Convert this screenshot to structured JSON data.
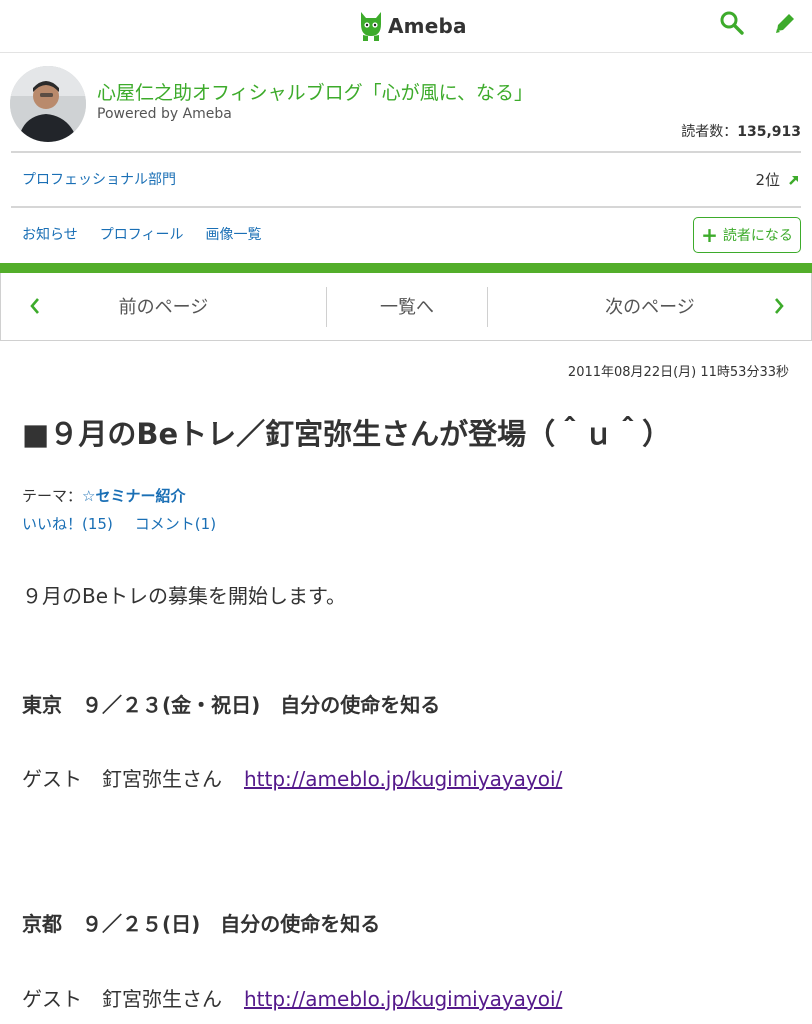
{
  "header": {
    "logo_text": "Ameba",
    "icons": [
      "search-icon",
      "pen-icon"
    ],
    "accent_color": "#3dab2b"
  },
  "profile": {
    "blog_title": "心屋仁之助オフィシャルブログ「心が風に、なる」",
    "powered_by": "Powered by Ameba",
    "readers_label": "読者数：",
    "readers_count": "135,913"
  },
  "ranking": {
    "category": "プロフェッショナル部門",
    "position": "2位"
  },
  "nav": {
    "links": [
      "お知らせ",
      "プロフィール",
      "画像一覧"
    ],
    "follow_label": "読者になる"
  },
  "pager": {
    "prev": "前のページ",
    "list": "一覧へ",
    "next": "次のページ"
  },
  "post": {
    "date": "2011年08月22日(月) 11時53分33秒",
    "title": "■９月のBeトレ／釘宮弥生さんが登場（＾ｕ＾）",
    "theme_label": "テーマ：",
    "theme_value": "☆セミナー紹介",
    "likes": "いいね！(15)",
    "comments": "コメント(1)",
    "body": {
      "intro": "９月のBeトレの募集を開始します。",
      "event1": "東京　９／２３(金・祝日)　自分の使命を知る",
      "guest1_label": "ゲスト　釘宮弥生さん",
      "guest1_link": "http://ameblo.jp/kugimiyayayoi/",
      "event2": "京都　９／２５(日)　自分の使命を知る",
      "guest2_label": "ゲスト　釘宮弥生さん",
      "guest2_link": "http://ameblo.jp/kugimiyayayoi/"
    }
  }
}
